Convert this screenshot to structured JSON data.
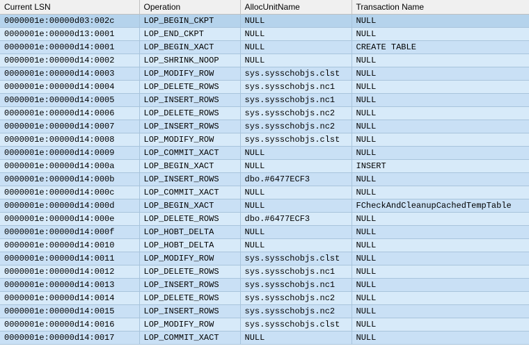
{
  "columns": [
    {
      "key": "lsn",
      "label": "Current LSN"
    },
    {
      "key": "operation",
      "label": "Operation"
    },
    {
      "key": "allocUnitName",
      "label": "AllocUnitName"
    },
    {
      "key": "transactionName",
      "label": "Transaction Name"
    }
  ],
  "rows": [
    {
      "lsn": "0000001e:00000d03:002c",
      "operation": "LOP_BEGIN_CKPT",
      "allocUnitName": "NULL",
      "transactionName": "NULL"
    },
    {
      "lsn": "0000001e:00000d13:0001",
      "operation": "LOP_END_CKPT",
      "allocUnitName": "NULL",
      "transactionName": "NULL"
    },
    {
      "lsn": "0000001e:00000d14:0001",
      "operation": "LOP_BEGIN_XACT",
      "allocUnitName": "NULL",
      "transactionName": "CREATE TABLE"
    },
    {
      "lsn": "0000001e:00000d14:0002",
      "operation": "LOP_SHRINK_NOOP",
      "allocUnitName": "NULL",
      "transactionName": "NULL"
    },
    {
      "lsn": "0000001e:00000d14:0003",
      "operation": "LOP_MODIFY_ROW",
      "allocUnitName": "sys.sysschobjs.clst",
      "transactionName": "NULL"
    },
    {
      "lsn": "0000001e:00000d14:0004",
      "operation": "LOP_DELETE_ROWS",
      "allocUnitName": "sys.sysschobjs.nc1",
      "transactionName": "NULL"
    },
    {
      "lsn": "0000001e:00000d14:0005",
      "operation": "LOP_INSERT_ROWS",
      "allocUnitName": "sys.sysschobjs.nc1",
      "transactionName": "NULL"
    },
    {
      "lsn": "0000001e:00000d14:0006",
      "operation": "LOP_DELETE_ROWS",
      "allocUnitName": "sys.sysschobjs.nc2",
      "transactionName": "NULL"
    },
    {
      "lsn": "0000001e:00000d14:0007",
      "operation": "LOP_INSERT_ROWS",
      "allocUnitName": "sys.sysschobjs.nc2",
      "transactionName": "NULL"
    },
    {
      "lsn": "0000001e:00000d14:0008",
      "operation": "LOP_MODIFY_ROW",
      "allocUnitName": "sys.sysschobjs.clst",
      "transactionName": "NULL"
    },
    {
      "lsn": "0000001e:00000d14:0009",
      "operation": "LOP_COMMIT_XACT",
      "allocUnitName": "NULL",
      "transactionName": "NULL"
    },
    {
      "lsn": "0000001e:00000d14:000a",
      "operation": "LOP_BEGIN_XACT",
      "allocUnitName": "NULL",
      "transactionName": "INSERT"
    },
    {
      "lsn": "0000001e:00000d14:000b",
      "operation": "LOP_INSERT_ROWS",
      "allocUnitName": "dbo.#6477ECF3",
      "transactionName": "NULL"
    },
    {
      "lsn": "0000001e:00000d14:000c",
      "operation": "LOP_COMMIT_XACT",
      "allocUnitName": "NULL",
      "transactionName": "NULL"
    },
    {
      "lsn": "0000001e:00000d14:000d",
      "operation": "LOP_BEGIN_XACT",
      "allocUnitName": "NULL",
      "transactionName": "FCheckAndCleanupCachedTempTable"
    },
    {
      "lsn": "0000001e:00000d14:000e",
      "operation": "LOP_DELETE_ROWS",
      "allocUnitName": "dbo.#6477ECF3",
      "transactionName": "NULL"
    },
    {
      "lsn": "0000001e:00000d14:000f",
      "operation": "LOP_HOBT_DELTA",
      "allocUnitName": "NULL",
      "transactionName": "NULL"
    },
    {
      "lsn": "0000001e:00000d14:0010",
      "operation": "LOP_HOBT_DELTA",
      "allocUnitName": "NULL",
      "transactionName": "NULL"
    },
    {
      "lsn": "0000001e:00000d14:0011",
      "operation": "LOP_MODIFY_ROW",
      "allocUnitName": "sys.sysschobjs.clst",
      "transactionName": "NULL"
    },
    {
      "lsn": "0000001e:00000d14:0012",
      "operation": "LOP_DELETE_ROWS",
      "allocUnitName": "sys.sysschobjs.nc1",
      "transactionName": "NULL"
    },
    {
      "lsn": "0000001e:00000d14:0013",
      "operation": "LOP_INSERT_ROWS",
      "allocUnitName": "sys.sysschobjs.nc1",
      "transactionName": "NULL"
    },
    {
      "lsn": "0000001e:00000d14:0014",
      "operation": "LOP_DELETE_ROWS",
      "allocUnitName": "sys.sysschobjs.nc2",
      "transactionName": "NULL"
    },
    {
      "lsn": "0000001e:00000d14:0015",
      "operation": "LOP_INSERT_ROWS",
      "allocUnitName": "sys.sysschobjs.nc2",
      "transactionName": "NULL"
    },
    {
      "lsn": "0000001e:00000d14:0016",
      "operation": "LOP_MODIFY_ROW",
      "allocUnitName": "sys.sysschobjs.clst",
      "transactionName": "NULL"
    },
    {
      "lsn": "0000001e:00000d14:0017",
      "operation": "LOP_COMMIT_XACT",
      "allocUnitName": "NULL",
      "transactionName": "NULL"
    }
  ],
  "selectedRow": 0
}
